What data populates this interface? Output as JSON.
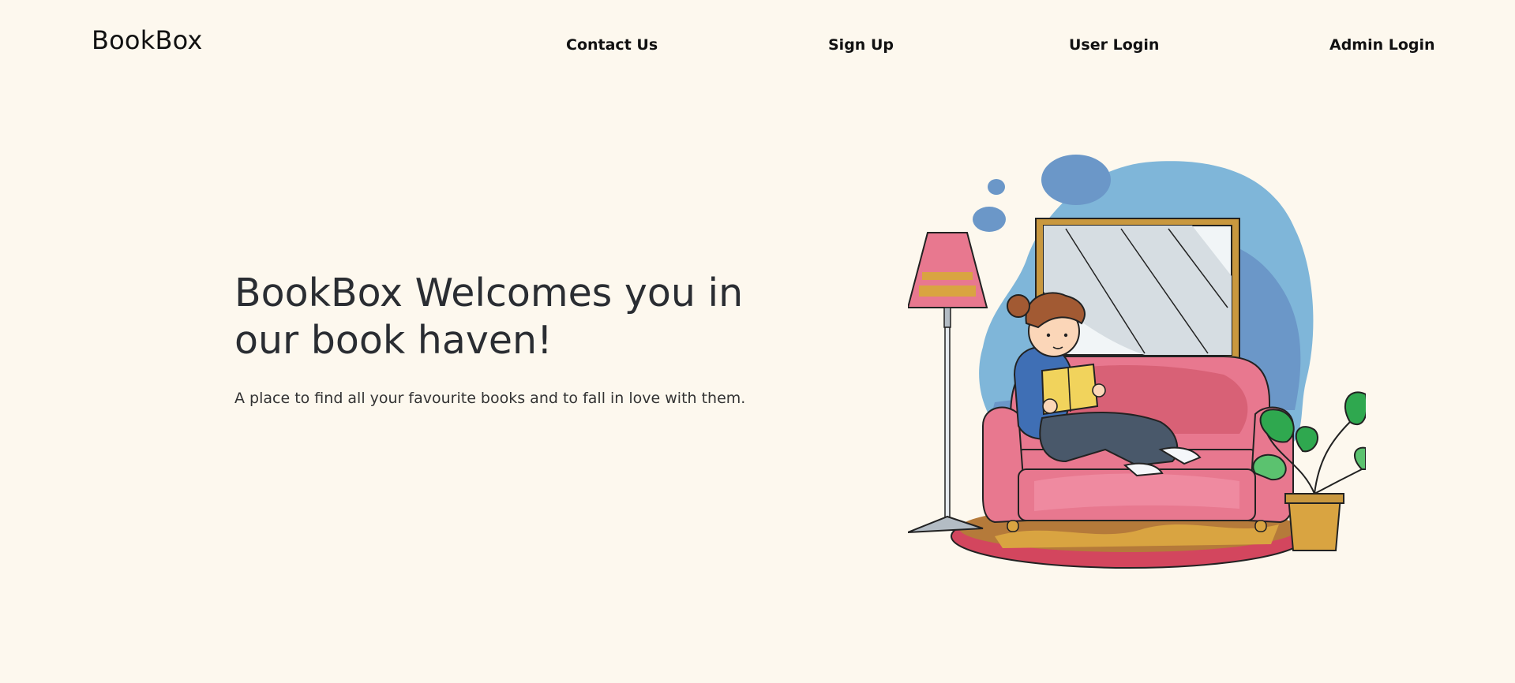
{
  "header": {
    "brand": "BookBox",
    "nav": {
      "contact": "Contact Us",
      "signup": "Sign Up",
      "user_login": "User Login",
      "admin_login": "Admin Login"
    }
  },
  "hero": {
    "title": "BookBox Welcomes you in our book haven!",
    "subtitle": "A place to find all your favourite books and to fall in love with them."
  },
  "colors": {
    "background": "#fdf8ee",
    "blob_blue": "#7fb6d9",
    "blob_dark_blue": "#6b97c8",
    "sofa_pink": "#e8788f",
    "mustard": "#d9a441",
    "plant_green": "#2fa84f"
  }
}
